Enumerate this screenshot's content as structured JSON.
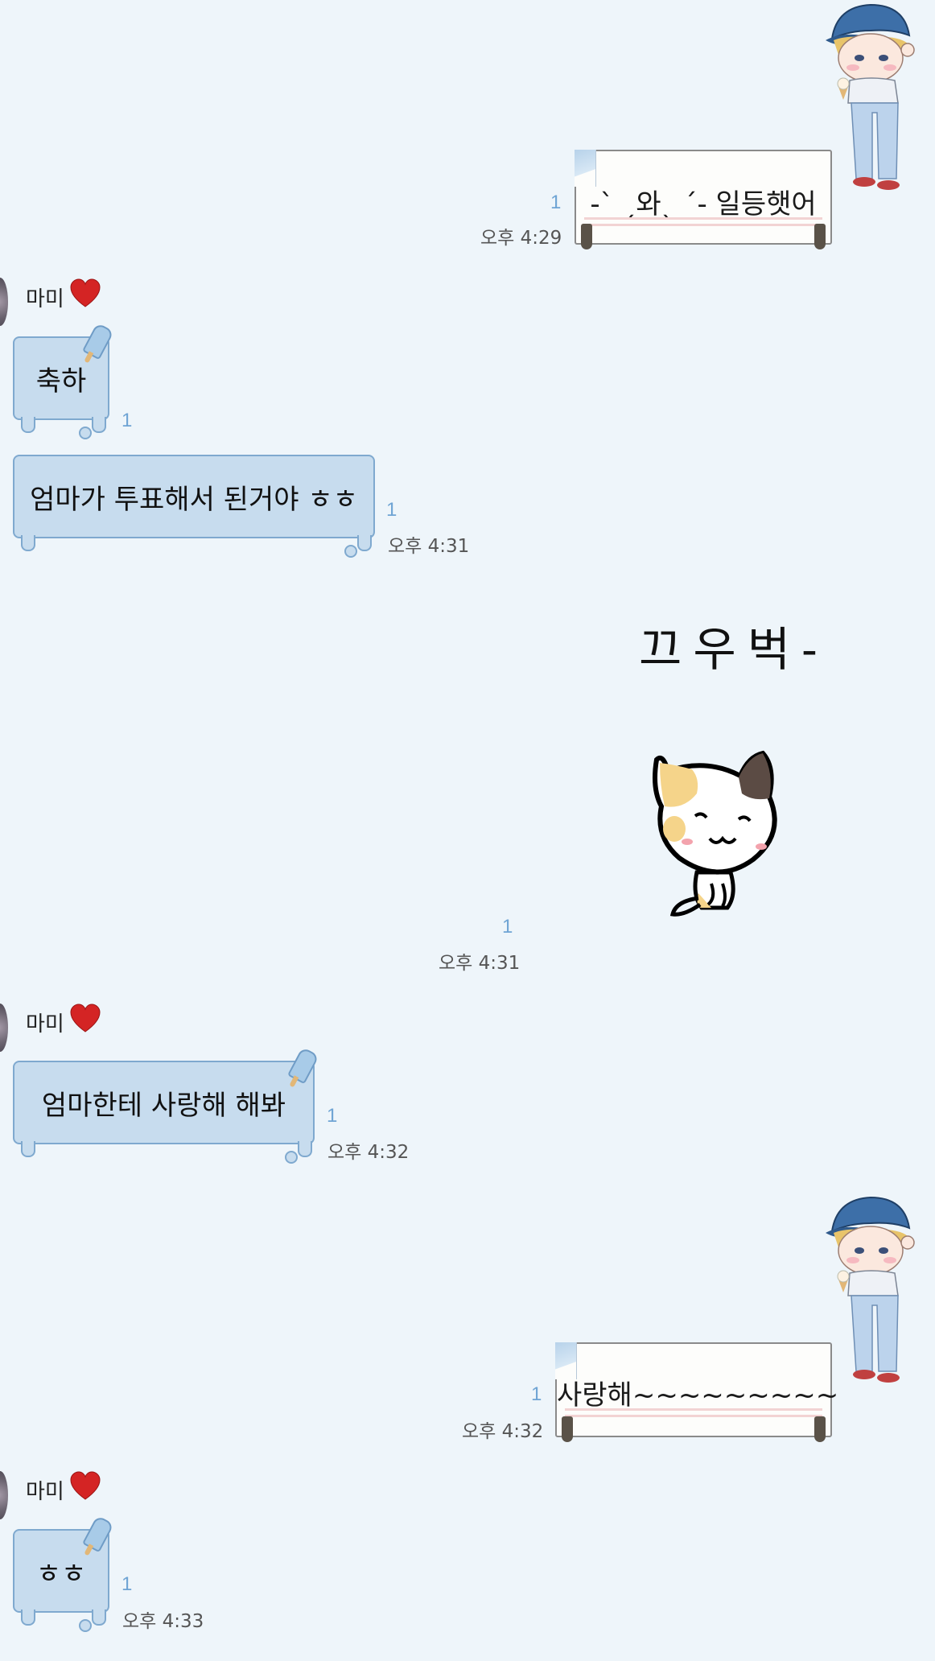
{
  "chat": {
    "messages": [
      {
        "id": "m1",
        "from": "me",
        "kind": "sign",
        "text": "-ˋ ˏ와ˎ ˊ- 일등햇어",
        "unread": "1",
        "time": "오후 4:29"
      },
      {
        "id": "m2",
        "from": "other",
        "sender": "마미",
        "kind": "bubble",
        "text": "축하",
        "unread": "1"
      },
      {
        "id": "m3",
        "from": "other",
        "kind": "bubble",
        "text": "엄마가 투표해서 된거야 ㅎㅎ",
        "unread": "1",
        "time": "오후 4:31"
      },
      {
        "id": "m4",
        "from": "me",
        "kind": "sticker",
        "text": "끄우벅-",
        "unread": "1",
        "time": "오후 4:31"
      },
      {
        "id": "m5",
        "from": "other",
        "sender": "마미",
        "kind": "bubble",
        "text": "엄마한테 사랑해 해봐",
        "unread": "1",
        "time": "오후 4:32"
      },
      {
        "id": "m6",
        "from": "me",
        "kind": "sign",
        "text": "사랑해~~~~~~~~~",
        "unread": "1",
        "time": "오후 4:32"
      },
      {
        "id": "m7",
        "from": "other",
        "sender": "마미",
        "kind": "bubble",
        "text": "ㅎㅎ",
        "unread": "1",
        "time": "오후 4:33"
      }
    ]
  },
  "colors": {
    "background": "#eef5fa",
    "bubble_fill": "#c7dcee",
    "bubble_border": "#7fa9cf",
    "unread": "#6fa4d4",
    "heart": "#d42424"
  },
  "icons": {
    "heart": "heart-icon",
    "popsicle": "popsicle-icon",
    "character": "boy-with-cap-character-icon",
    "cat": "calico-cat-sticker-icon"
  }
}
